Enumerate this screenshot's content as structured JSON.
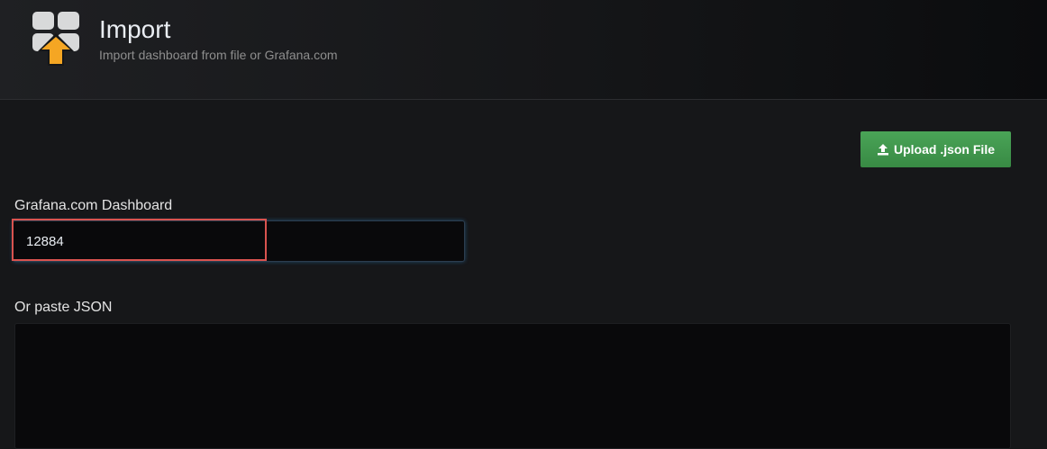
{
  "header": {
    "title": "Import",
    "subtitle": "Import dashboard from file or Grafana.com",
    "logo_icon": "dashboard-import-icon"
  },
  "toolbar": {
    "upload_label": "Upload .json File",
    "upload_icon": "upload-icon"
  },
  "grafana_com": {
    "label": "Grafana.com Dashboard",
    "value": "12884"
  },
  "json_paste": {
    "label": "Or paste JSON",
    "value": ""
  },
  "colors": {
    "accent_green": "#3f974a",
    "highlight_red": "#d9534f",
    "upload_arrow": "#f5a623",
    "background": "#161719"
  }
}
